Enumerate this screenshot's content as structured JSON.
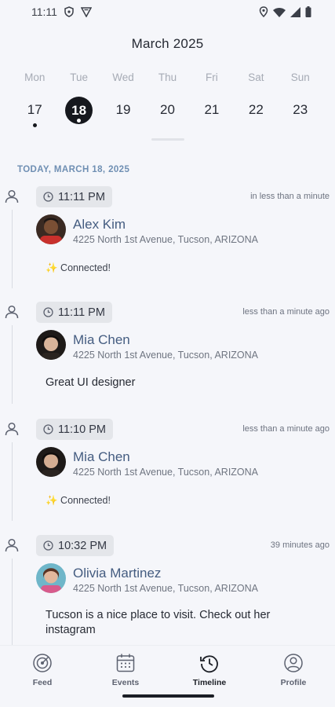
{
  "status_bar": {
    "time": "11:11"
  },
  "calendar": {
    "month_title": "March 2025",
    "weekdays": [
      "Mon",
      "Tue",
      "Wed",
      "Thu",
      "Fri",
      "Sat",
      "Sun"
    ],
    "dates": [
      "17",
      "18",
      "19",
      "20",
      "21",
      "22",
      "23"
    ],
    "selected_index": 1
  },
  "timeline": {
    "section_label": "TODAY, MARCH 18, 2025",
    "entries": [
      {
        "time": "11:11 PM",
        "relative": "in less than a minute",
        "name": "Alex Kim",
        "address": "4225 North 1st Avenue, Tucson, ARIZONA",
        "message": "✨ Connected!"
      },
      {
        "time": "11:11 PM",
        "relative": "less than a minute ago",
        "name": "Mia Chen",
        "address": "4225 North 1st Avenue, Tucson, ARIZONA",
        "message": "Great UI designer"
      },
      {
        "time": "11:10 PM",
        "relative": "less than a minute ago",
        "name": "Mia Chen",
        "address": "4225 North 1st Avenue, Tucson, ARIZONA",
        "message": "✨ Connected!"
      },
      {
        "time": "10:32 PM",
        "relative": "39 minutes ago",
        "name": "Olivia Martinez",
        "address": "4225 North 1st Avenue, Tucson, ARIZONA",
        "message": "Tucson is a nice place to visit. Check out her instagram"
      }
    ]
  },
  "nav": {
    "items": [
      {
        "label": "Feed",
        "icon": "radar-icon"
      },
      {
        "label": "Events",
        "icon": "calendar-icon"
      },
      {
        "label": "Timeline",
        "icon": "history-icon"
      },
      {
        "label": "Profile",
        "icon": "user-circle-icon"
      }
    ],
    "active_index": 2
  },
  "colors": {
    "accent_name": "#445c80",
    "section_label": "#6f8fb3",
    "selected_date_bg": "#16181d"
  }
}
